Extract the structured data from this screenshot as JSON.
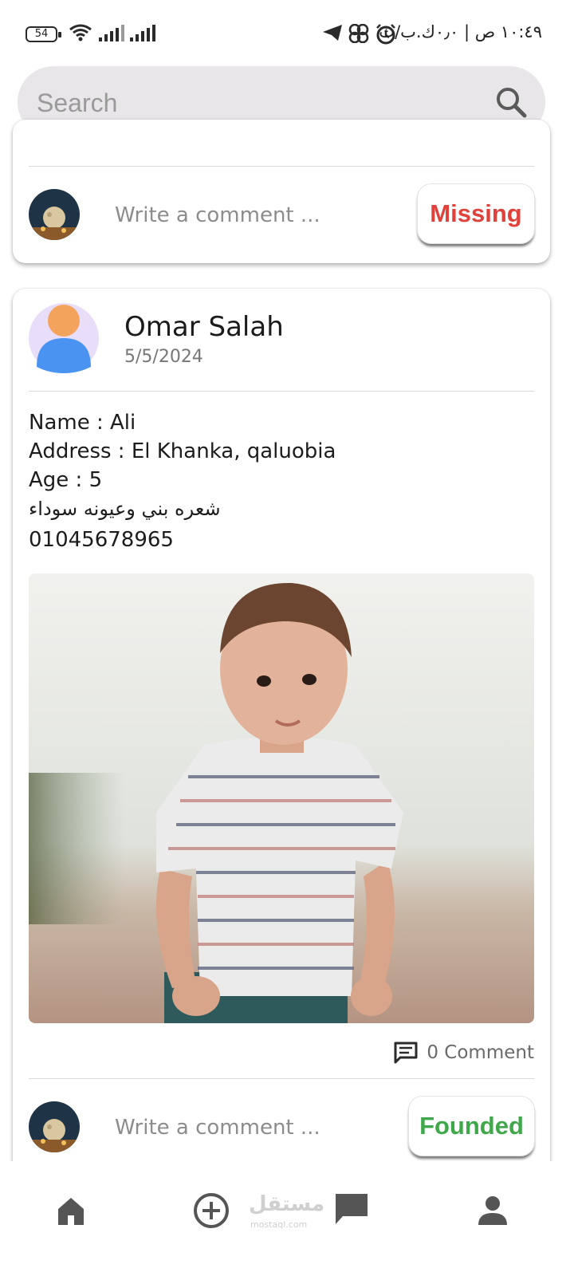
{
  "status_bar": {
    "time": "١٠:٤٩ ص | ٠٫٠ك.ب/ث",
    "battery": "54",
    "icons": [
      "telegram-icon",
      "pinwheel-icon",
      "alarm-icon",
      "wifi-icon",
      "signal-icon",
      "signal-icon"
    ]
  },
  "search": {
    "placeholder": "Search"
  },
  "card_top": {
    "comment_placeholder": "Write a comment ...",
    "status_label": "Missing"
  },
  "post": {
    "author": "Omar Salah",
    "date": "5/5/2024",
    "name_line": "Name : Ali",
    "address_line": "Address : El Khanka, qaluobia",
    "age_line": "Age : 5",
    "description": "شعره بني وعيونه سوداء",
    "phone": "01045678965",
    "comment_count": "0 Comment",
    "comment_placeholder": "Write a comment ...",
    "status_label": "Founded"
  },
  "bottom_nav": {
    "items": [
      "home-icon",
      "add-icon",
      "chat-icon",
      "profile-icon"
    ],
    "watermark": "مستقل",
    "watermark_sub": "mostaql.com"
  },
  "colors": {
    "missing": "#e0413a",
    "founded": "#3fa84a",
    "search_bg": "#e8e6e8",
    "nav_icon": "#555555"
  }
}
